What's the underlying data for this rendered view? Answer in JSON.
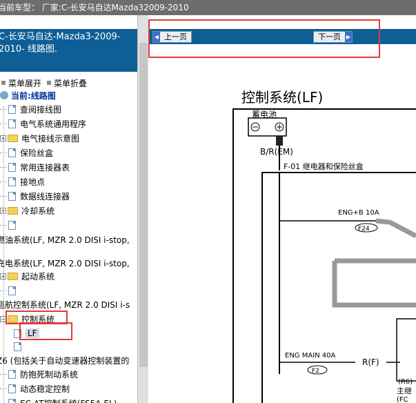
{
  "titlebar": {
    "text": "当前车型： 厂家:C-长安马自达Mazda32009-2010"
  },
  "sidebar": {
    "header_line1": "C-长安马自达-Mazda3-2009-",
    "header_line2": "2010- 线路图.",
    "menu_expand": "菜单展开",
    "menu_collapse": "菜单折叠",
    "current_label": "当前:线路图",
    "items": [
      {
        "label": "查阅接线图",
        "type": "doc"
      },
      {
        "label": "电气系统通用程序",
        "type": "doc"
      },
      {
        "label": "电气接线示意图",
        "type": "folder"
      },
      {
        "label": "保险丝盒",
        "type": "doc"
      },
      {
        "label": "常用连接器表",
        "type": "doc"
      },
      {
        "label": "接地点",
        "type": "doc"
      },
      {
        "label": "数据线连接器",
        "type": "doc"
      },
      {
        "label": "冷却系统",
        "type": "folder"
      },
      {
        "label": "",
        "type": "doc"
      },
      {
        "label": "燃油系统(LF, MZR 2.0 DISI i-stop,",
        "type": "text"
      },
      {
        "label": "充电系统(LF, MZR 2.0 DISI i-stop,",
        "type": "text"
      },
      {
        "label": "起动系统",
        "type": "folder"
      },
      {
        "label": "",
        "type": "doc"
      },
      {
        "label": "巡航控制系统(LF, MZR 2.0 DISI i-s",
        "type": "text"
      },
      {
        "label": "控制系统",
        "type": "folder"
      },
      {
        "label": "LF",
        "type": "doc-selected"
      },
      {
        "label": "",
        "type": "doc"
      },
      {
        "label": "Z6 (包括关于自动变速器控制装置的",
        "type": "text"
      },
      {
        "label": "防抱死制动系统",
        "type": "doc"
      },
      {
        "label": "动态稳定控制",
        "type": "doc"
      },
      {
        "label": "EC-AT控制系统(FS5A-EL)",
        "type": "doc"
      }
    ]
  },
  "nav": {
    "prev_label": "上一页",
    "next_label": "下一页"
  },
  "diagram": {
    "title": "控制系统(LF)",
    "battery_label": "蓄电池",
    "minus": "⊖",
    "plus": "⊕",
    "wire_br": "B/R(EM)",
    "fuse_box_label": "F-01  继电器和保险丝盒",
    "eng_b": "ENG+B 10A",
    "f24": "F24",
    "eng_main": "ENG MAIN 40A",
    "f2": "F2",
    "rf": "R(F)",
    "r6": "(R6)",
    "main_relay": "主继",
    "fc": "(FC"
  },
  "colors": {
    "header_blue": "#0d5f95",
    "title_gray": "#6d6d6d",
    "highlight_red": "#e03a3a"
  }
}
